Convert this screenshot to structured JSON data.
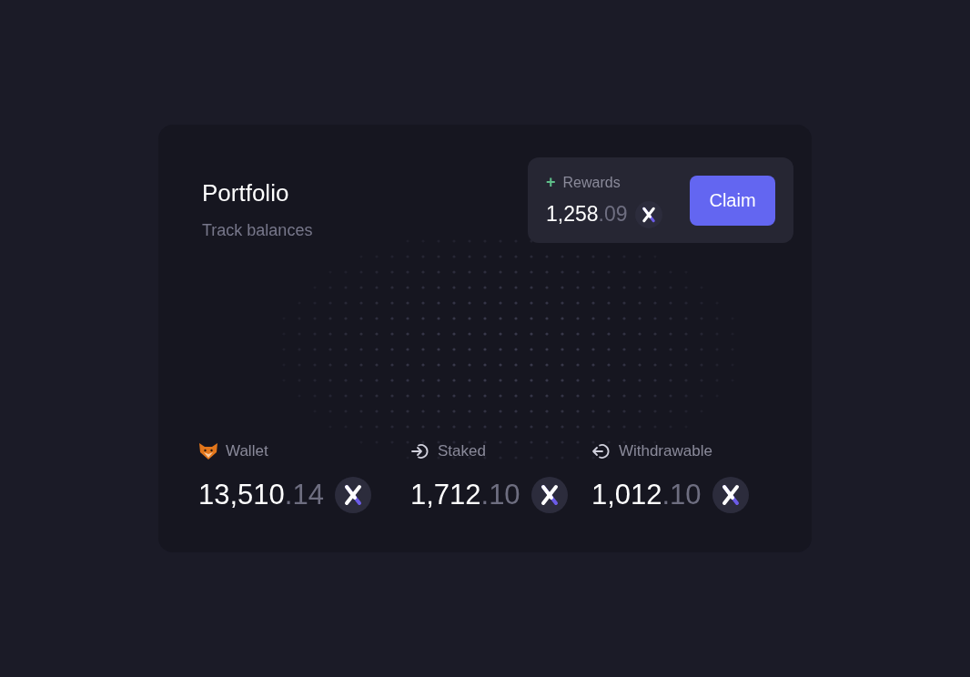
{
  "header": {
    "title": "Portfolio",
    "subtitle": "Track balances"
  },
  "rewards": {
    "icon": "+",
    "label": "Rewards",
    "whole": "1,258",
    "fraction": ".09",
    "button": "Claim"
  },
  "balances": [
    {
      "kind": "wallet",
      "label": "Wallet",
      "whole": "13,510",
      "fraction": ".14"
    },
    {
      "kind": "staked",
      "label": "Staked",
      "whole": "1,712",
      "fraction": ".10"
    },
    {
      "kind": "withdrawable",
      "label": "Withdrawable",
      "whole": "1,012",
      "fraction": ".10"
    }
  ]
}
